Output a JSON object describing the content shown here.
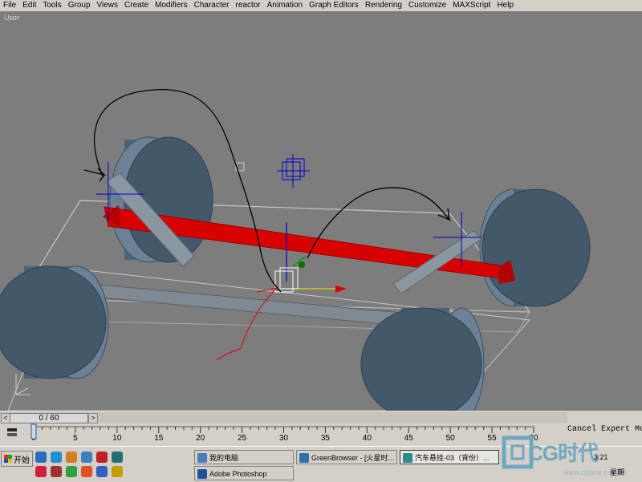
{
  "menu": [
    "File",
    "Edit",
    "Tools",
    "Group",
    "Views",
    "Create",
    "Modifiers",
    "Character",
    "reactor",
    "Animation",
    "Graph Editors",
    "Rendering",
    "Customize",
    "MAXScript",
    "Help"
  ],
  "viewport": {
    "label": "User"
  },
  "timeslider": {
    "frame": "0 / 60",
    "left_arrow": "<",
    "right_arrow": ">"
  },
  "track": {
    "ticks": [
      "0",
      "5",
      "10",
      "15",
      "20",
      "25",
      "30",
      "35",
      "40",
      "45",
      "50",
      "55",
      "60"
    ]
  },
  "status": {
    "prompt": "Cancel Expert Mode"
  },
  "taskbar": {
    "start": "开始",
    "tasks": [
      {
        "label": "我的电脑"
      },
      {
        "label": "GreenBrowser - [火星时..."
      },
      {
        "label": "汽车悬挂-03（背份）..."
      },
      {
        "label": "Adobe Photoshop"
      }
    ],
    "clock": "3:21",
    "day": "星期"
  },
  "watermark": {
    "text": "CG时代",
    "url": "www.cgtime.com.cn"
  },
  "colors": {
    "viewport": "#7d7d7d",
    "wheel": "#4d6378",
    "axle": "#d80000",
    "chrome": "#d4d0c8"
  },
  "icons": [
    "windows-flag-icon",
    "tv-icon",
    "ie-icon",
    "outlook-icon",
    "media-icon",
    "gear-icon",
    "arrow-icon",
    "bird-icon",
    "flower-icon",
    "pinwheel-icon",
    "headphones-icon",
    "network-icon",
    "3dsmax-icon",
    "photoshop-icon"
  ]
}
